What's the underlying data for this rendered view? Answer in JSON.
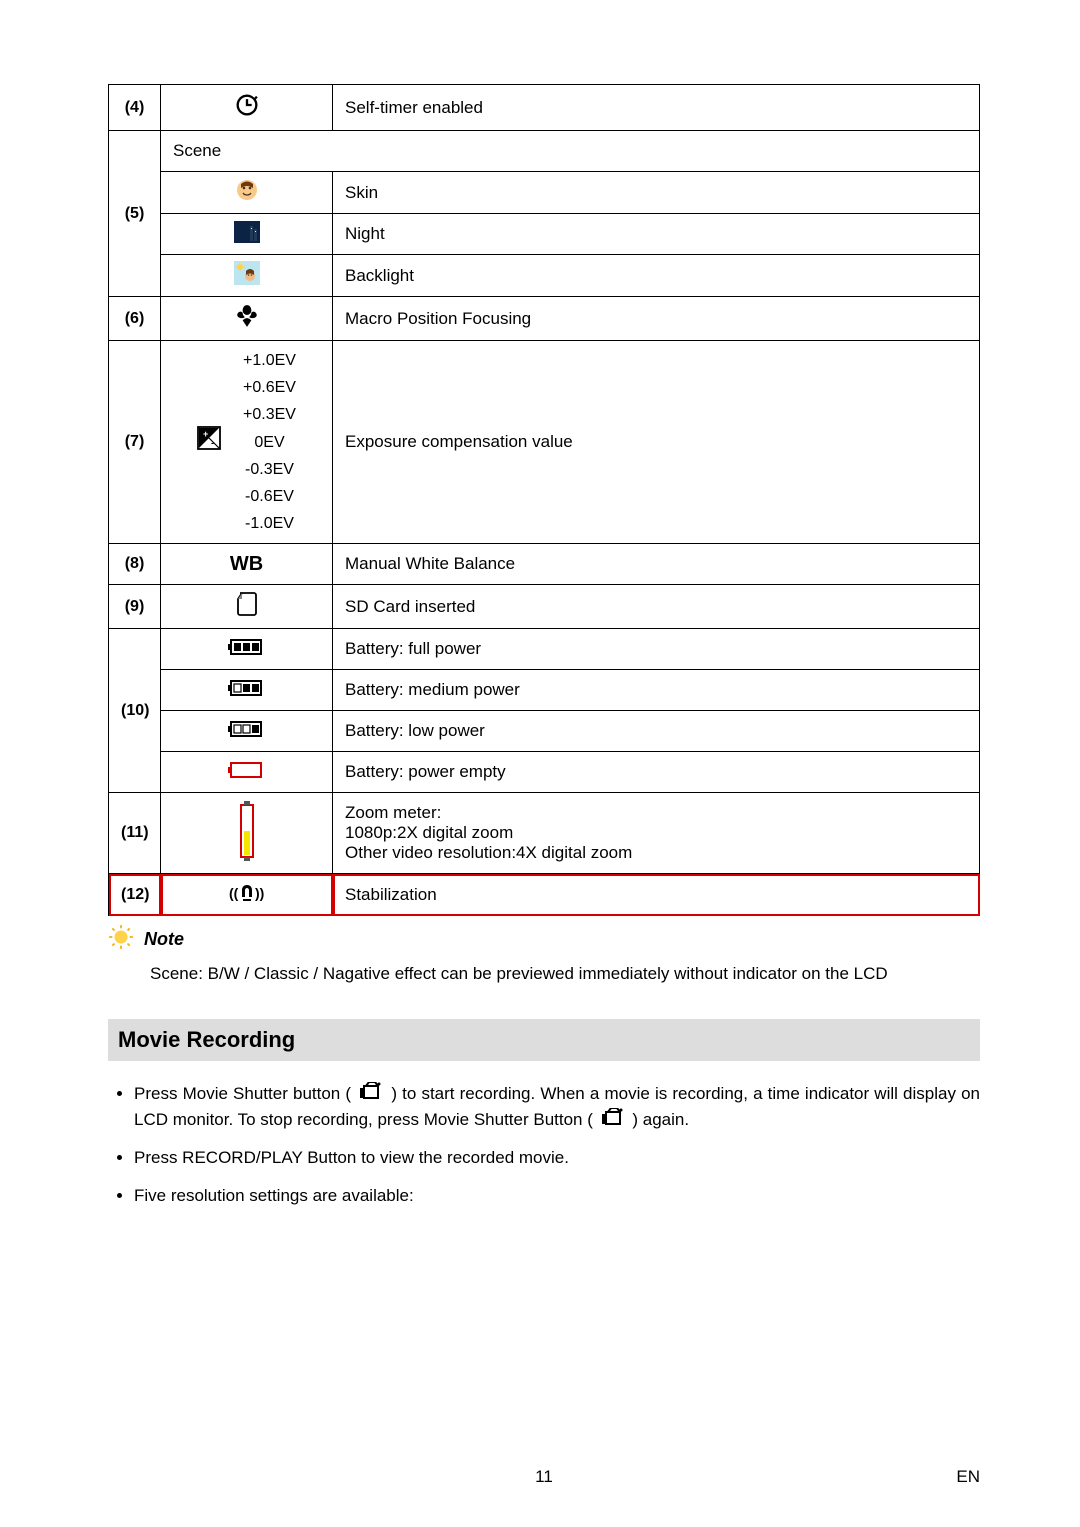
{
  "rows": {
    "r4": {
      "num": "(4)",
      "desc": "Self-timer enabled"
    },
    "r5": {
      "num": "(5)",
      "header": "Scene",
      "skin": "Skin",
      "night": "Night",
      "backlight": "Backlight"
    },
    "r6": {
      "num": "(6)",
      "desc": "Macro Position Focusing"
    },
    "r7": {
      "num": "(7)",
      "ev": [
        "+1.0EV",
        "+0.6EV",
        "+0.3EV",
        "0EV",
        "-0.3EV",
        "-0.6EV",
        "-1.0EV"
      ],
      "desc": "Exposure compensation value"
    },
    "r8": {
      "num": "(8)",
      "label": "WB",
      "desc": "Manual White Balance"
    },
    "r9": {
      "num": "(9)",
      "desc": "SD Card inserted"
    },
    "r10": {
      "num": "(10)",
      "full": "Battery: full power",
      "med": "Battery: medium power",
      "low": "Battery: low power",
      "empty": "Battery: power empty"
    },
    "r11": {
      "num": "(11)",
      "desc": "Zoom meter:\n1080p:2X digital zoom\nOther video resolution:4X digital zoom"
    },
    "r12": {
      "num": "(12)",
      "desc": "Stabilization"
    }
  },
  "note": {
    "title": "Note",
    "body": "Scene: B/W / Classic / Nagative effect can be previewed immediately without indicator on the LCD"
  },
  "section": {
    "title": "Movie Recording"
  },
  "bullets": {
    "b1a": "Press Movie Shutter button (",
    "b1b": ") to start recording. When a movie is recording, a time indicator will display on LCD monitor. To stop recording, press Movie Shutter Button (",
    "b1c": ") again.",
    "b2": "Press RECORD/PLAY Button to view the recorded movie.",
    "b3": "Five resolution settings are available:"
  },
  "footer": {
    "page": "11",
    "lang": "EN"
  }
}
